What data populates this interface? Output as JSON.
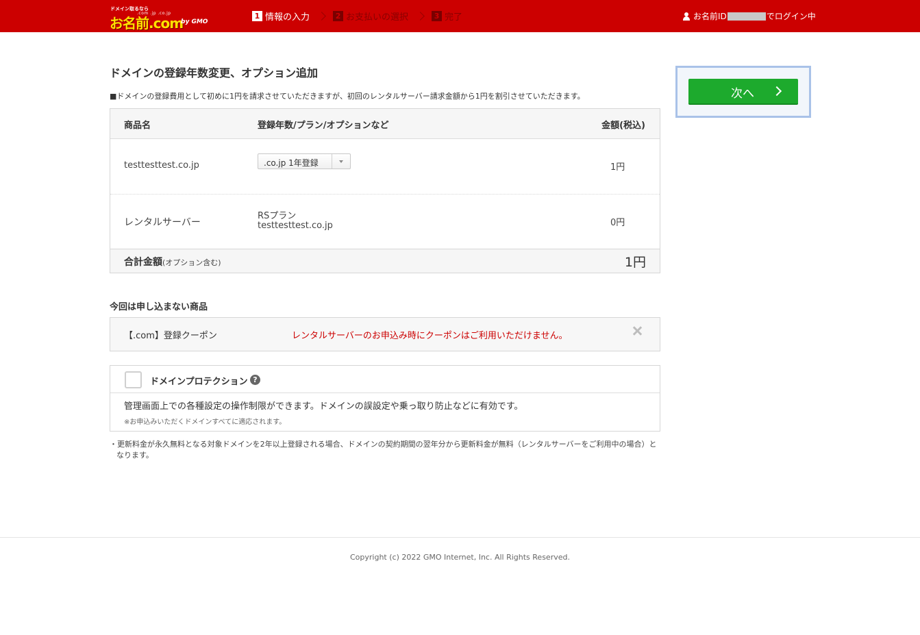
{
  "header": {
    "logo": {
      "tagline": "ドメイン取るなら",
      "tlds": ".com .jp .co.jp",
      "name": "お名前.com",
      "by": "by GMO"
    },
    "steps": [
      {
        "num": "1",
        "label": "情報の入力",
        "active": true
      },
      {
        "num": "2",
        "label": "お支払いの選択",
        "active": false
      },
      {
        "num": "3",
        "label": "完了",
        "active": false
      }
    ],
    "login": {
      "prefix": "お名前ID",
      "suffix": "でログイン中"
    }
  },
  "main": {
    "title": "ドメインの登録年数変更、オプション追加",
    "notice": "■ドメインの登録費用として初めに1円を請求させていただきますが、初回のレンタルサーバー請求金額から1円を割引させていただきます。",
    "table": {
      "headers": {
        "product": "商品名",
        "plan": "登録年数/プラン/オプションなど",
        "price": "金額(税込)"
      },
      "rows": [
        {
          "product": "testtesttest.co.jp",
          "plan_select": ".co.jp 1年登録",
          "price": "1円"
        },
        {
          "product": "レンタルサーバー",
          "plan_line1": "RSプラン",
          "plan_line2": "testtesttest.co.jp",
          "price": "0円"
        }
      ],
      "total": {
        "label": "合計金額",
        "sub": "(オプション含む)",
        "amount": "1円"
      }
    },
    "excluded": {
      "title": "今回は申し込まない商品",
      "item": "【.com】登録クーポン",
      "message": "レンタルサーバーのお申込み時にクーポンはご利用いただけません。"
    },
    "protection": {
      "title": "ドメインプロテクション",
      "help": "?",
      "description": "管理画面上での各種設定の操作制限ができます。ドメインの誤設定や乗っ取り防止などに有効です。",
      "note": "※お申込みいただくドメインすべてに適応されます。",
      "checked": false
    },
    "footnote": "・更新料金が永久無料となる対象ドメインを2年以上登録される場合、ドメインの契約期間の翌年分から更新料金が無料（レンタルサーバーをご利用中の場合）となります。"
  },
  "side": {
    "next_label": "次へ"
  },
  "footer": {
    "copyright": "Copyright (c) 2022 GMO Internet, Inc. All Rights Reserved."
  },
  "colors": {
    "header_bg": "#cc0000",
    "next_button": "#1daa2d",
    "error_text": "#cc0000",
    "side_border": "#a9c2e8"
  }
}
